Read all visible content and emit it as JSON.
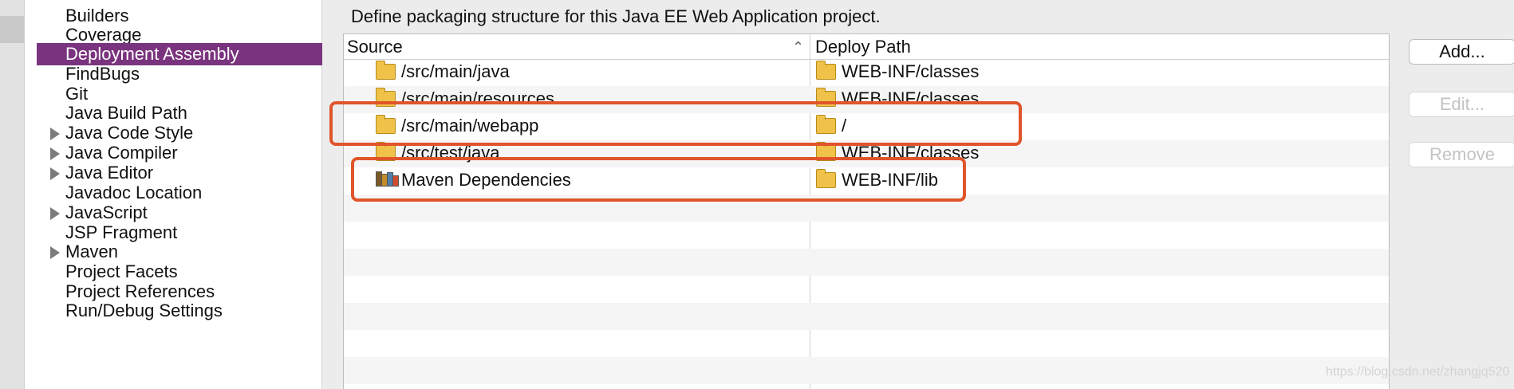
{
  "sidebar": {
    "items": [
      {
        "label": "Builders",
        "expandable": false
      },
      {
        "label": "Coverage",
        "expandable": false
      },
      {
        "label": "Deployment Assembly",
        "expandable": false,
        "selected": true
      },
      {
        "label": "FindBugs",
        "expandable": false
      },
      {
        "label": "Git",
        "expandable": false
      },
      {
        "label": "Java Build Path",
        "expandable": false
      },
      {
        "label": "Java Code Style",
        "expandable": true
      },
      {
        "label": "Java Compiler",
        "expandable": true
      },
      {
        "label": "Java Editor",
        "expandable": true
      },
      {
        "label": "Javadoc Location",
        "expandable": false
      },
      {
        "label": "JavaScript",
        "expandable": true
      },
      {
        "label": "JSP Fragment",
        "expandable": false
      },
      {
        "label": "Maven",
        "expandable": true
      },
      {
        "label": "Project Facets",
        "expandable": false
      },
      {
        "label": "Project References",
        "expandable": false
      },
      {
        "label": "Run/Debug Settings",
        "expandable": false
      }
    ]
  },
  "main": {
    "description": "Define packaging structure for this Java EE Web Application project.",
    "table": {
      "columns": {
        "source": "Source",
        "deploy_path": "Deploy Path"
      },
      "rows": [
        {
          "source": "/src/main/java",
          "deploy_path": "WEB-INF/classes",
          "source_icon": "folder-icon"
        },
        {
          "source": "/src/main/resources",
          "deploy_path": "WEB-INF/classes",
          "source_icon": "folder-icon"
        },
        {
          "source": "/src/main/webapp",
          "deploy_path": "/",
          "source_icon": "folder-icon"
        },
        {
          "source": "/src/test/java",
          "deploy_path": "WEB-INF/classes",
          "source_icon": "folder-icon"
        },
        {
          "source": "Maven Dependencies",
          "deploy_path": "WEB-INF/lib",
          "source_icon": "library-icon"
        }
      ]
    },
    "buttons": {
      "add": "Add...",
      "edit": "Edit...",
      "remove": "Remove"
    },
    "watermark": "https://blog.csdn.net/zhangjq520"
  },
  "colors": {
    "selection": "#7a347f",
    "highlight": "#e0552a",
    "folder": "#f0c24a"
  }
}
